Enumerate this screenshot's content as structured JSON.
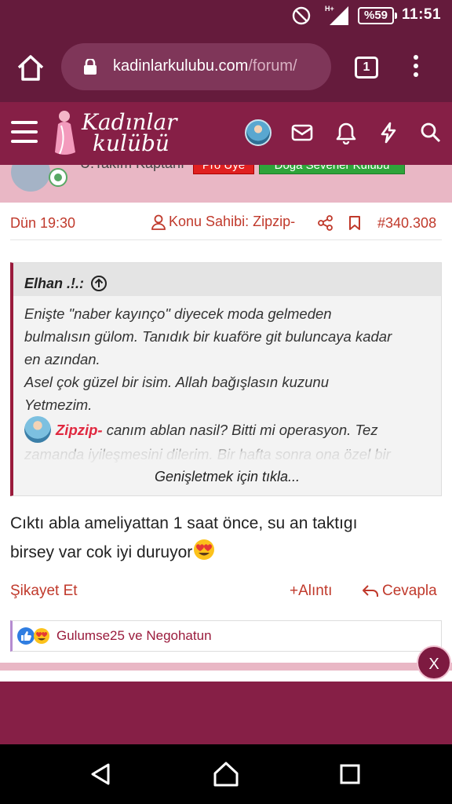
{
  "status_bar": {
    "time": "11:51",
    "battery": "%59",
    "network": "H+"
  },
  "browser": {
    "url_host": "kadinlarkulubu.com",
    "url_path": "/forum/",
    "tab_count": "1"
  },
  "site": {
    "logo_line1": "Kadınlar",
    "logo_line2": "kulübü"
  },
  "prev_post": {
    "title_fragment": "U.Takım Kaptanı",
    "badge_pro": "Pro Üye",
    "badge_group": "Doğa Severler Kulübü"
  },
  "post": {
    "date": "Dün 19:30",
    "author_label": "Konu Sahibi: Zipzip-",
    "post_number": "#340.308",
    "quote": {
      "author": "Elhan .!.:",
      "lines": [
        "Enişte \"naber kayınço\" diyecek moda gelmeden",
        "bulmalısın gülom. Tanıdık bir kuaföre git buluncaya kadar",
        "en azından.",
        "Asel çok güzel bir isim. Allah bağışlasın kuzunu",
        "Yetmezim."
      ],
      "mention_name": "Zipzip-",
      "mention_text": " canım ablan nasil? Bitti mi operasyon. Tez",
      "faded_line": "zamanda iyileşmesini dilerim. Bir hafta sonra ona özel bir",
      "expand_label": "Genişletmek için tıkla..."
    },
    "body_line1": "Cıktı abla ameliyattan 1 saat önce, su an taktıgı",
    "body_line2": "birsey var cok iyi duruyor",
    "actions": {
      "report": "Şikayet Et",
      "quote": "Alıntı",
      "reply": "Cevapla"
    },
    "reactions_text": "Gulumse25 ve Negohatun"
  },
  "overlay": {
    "close_label": "X"
  },
  "colors": {
    "brand": "#861f46",
    "brand_dark": "#651b3c",
    "accent_red": "#c0392b",
    "page_pink": "#e9b7c5"
  }
}
